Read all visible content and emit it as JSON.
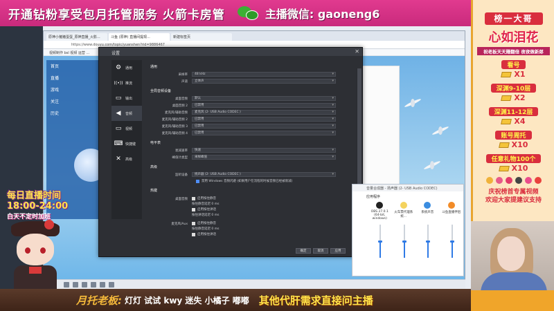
{
  "top_banner": {
    "promo": "开通钻粉享受包月托管服务 火箭卡房管",
    "wechat": "主播微信: gaoneng6"
  },
  "browser": {
    "tabs": [
      "原神小猪猪蛋蛋_原神直播_火影...",
      "斗鱼 (原神) 直播间提现...",
      "新建标签页"
    ],
    "address": "https://www.douyu.com/topic/yuanshen?rid=9886467",
    "bookmarks": "视频制作    bsl    视频    运营    ..."
  },
  "page": {
    "nav": [
      "首页",
      "直播",
      "游戏",
      "关注",
      "历史"
    ]
  },
  "obs": {
    "title": "设置",
    "nav": [
      {
        "label": "通用",
        "icon": "gear-icon",
        "glyph": "⚙"
      },
      {
        "label": "推流",
        "icon": "wifi-icon",
        "glyph": "((•))"
      },
      {
        "label": "输出",
        "icon": "output-icon",
        "glyph": "▭"
      },
      {
        "label": "音频",
        "icon": "speaker-icon",
        "glyph": "🔈"
      },
      {
        "label": "视频",
        "icon": "monitor-icon",
        "glyph": "▭"
      },
      {
        "label": "快捷键",
        "icon": "keyboard-icon",
        "glyph": "⌨"
      },
      {
        "label": "高级",
        "icon": "tools-icon",
        "glyph": "✕"
      }
    ],
    "sections": {
      "general": "通用",
      "global_audio": "全局音频设备",
      "meters": "电平表",
      "advanced": "高级",
      "hotkeys": "热键"
    },
    "general_rows": [
      {
        "label": "采样率",
        "value": "48 kHz"
      },
      {
        "label": "声道",
        "value": "立体声"
      }
    ],
    "audio_rows": [
      {
        "label": "桌面音频",
        "value": "默认"
      },
      {
        "label": "桌面音频 2",
        "value": "已禁用"
      },
      {
        "label": "麦克风/辅助音频",
        "value": "麦克风 (2- USB Audio CODEC )"
      },
      {
        "label": "麦克风/辅助音频 2",
        "value": "已禁用"
      },
      {
        "label": "麦克风/辅助音频 3",
        "value": "已禁用"
      },
      {
        "label": "麦克风/辅助音频 4",
        "value": "已禁用"
      }
    ],
    "meter_rows": [
      {
        "label": "衰减速率",
        "value": "快速"
      },
      {
        "label": "峰值计类型",
        "value": "采样峰值"
      }
    ],
    "advanced_rows": [
      {
        "label": "监听设备",
        "value": "扬声器 (2- USB Audio CODEC )"
      }
    ],
    "advanced_check": "禁用 Windows 音频闪避 (如果用户在流程的时候音频已经被衰减)",
    "hotkeys_groups": [
      {
        "label": "桌面音频",
        "checks": [
          "启用按住静音",
          "按住静音延迟 0 ms",
          "启用按住讲话",
          "按住讲话延迟 0 ms"
        ]
      },
      {
        "label": "麦克风/Aux",
        "checks": [
          "启用按住静音",
          "按住静音延迟 0 ms",
          "启用按住讲话",
          "按住讲话延迟 0 ms"
        ]
      }
    ],
    "buttons": {
      "ok": "确定",
      "cancel": "取消",
      "apply": "应用"
    }
  },
  "mixer": {
    "title": "音量合成器 - 扬声器 (2- USB Audio CODEC)",
    "heading": "应用程序",
    "apps": [
      {
        "name": "OBS 27.0.1 (64-bit, windows)",
        "color": "#1a1a1a"
      },
      {
        "name": "火车票代理系统...",
        "color": "#f4d35e"
      },
      {
        "name": "系统声音",
        "color": "#3b8de0"
      },
      {
        "name": "斗鱼直播伴侣",
        "color": "#f28c28"
      }
    ],
    "levels": [
      0.55,
      0.55,
      0.55,
      0.55
    ]
  },
  "schedule": {
    "line1": "每日直播时间",
    "line2": "18:00-24:00",
    "line3": "白天不定时加班"
  },
  "right_panel": {
    "title": "榜一大哥",
    "name": "心如泪花",
    "subtitle": "祝老板天天赚翻倍 夜夜做新郎",
    "items": [
      {
        "label": "看号",
        "value": "X1"
      },
      {
        "label": "深渊9-10层",
        "value": "X2"
      },
      {
        "label": "深渊11-12层",
        "value": "X4"
      },
      {
        "label": "账号周托",
        "value": "X10"
      },
      {
        "label": "任意礼物100个",
        "value": "X10"
      }
    ],
    "footer1": "庆祝榜首专属视频",
    "footer2": "欢迎大家提建议支持"
  },
  "bottom_banner": {
    "label": "月托老板:",
    "names": "灯灯 试试 kwy 迷失 小橘子 嘟嘟",
    "ask": "其他代肝需求直接问主播"
  }
}
